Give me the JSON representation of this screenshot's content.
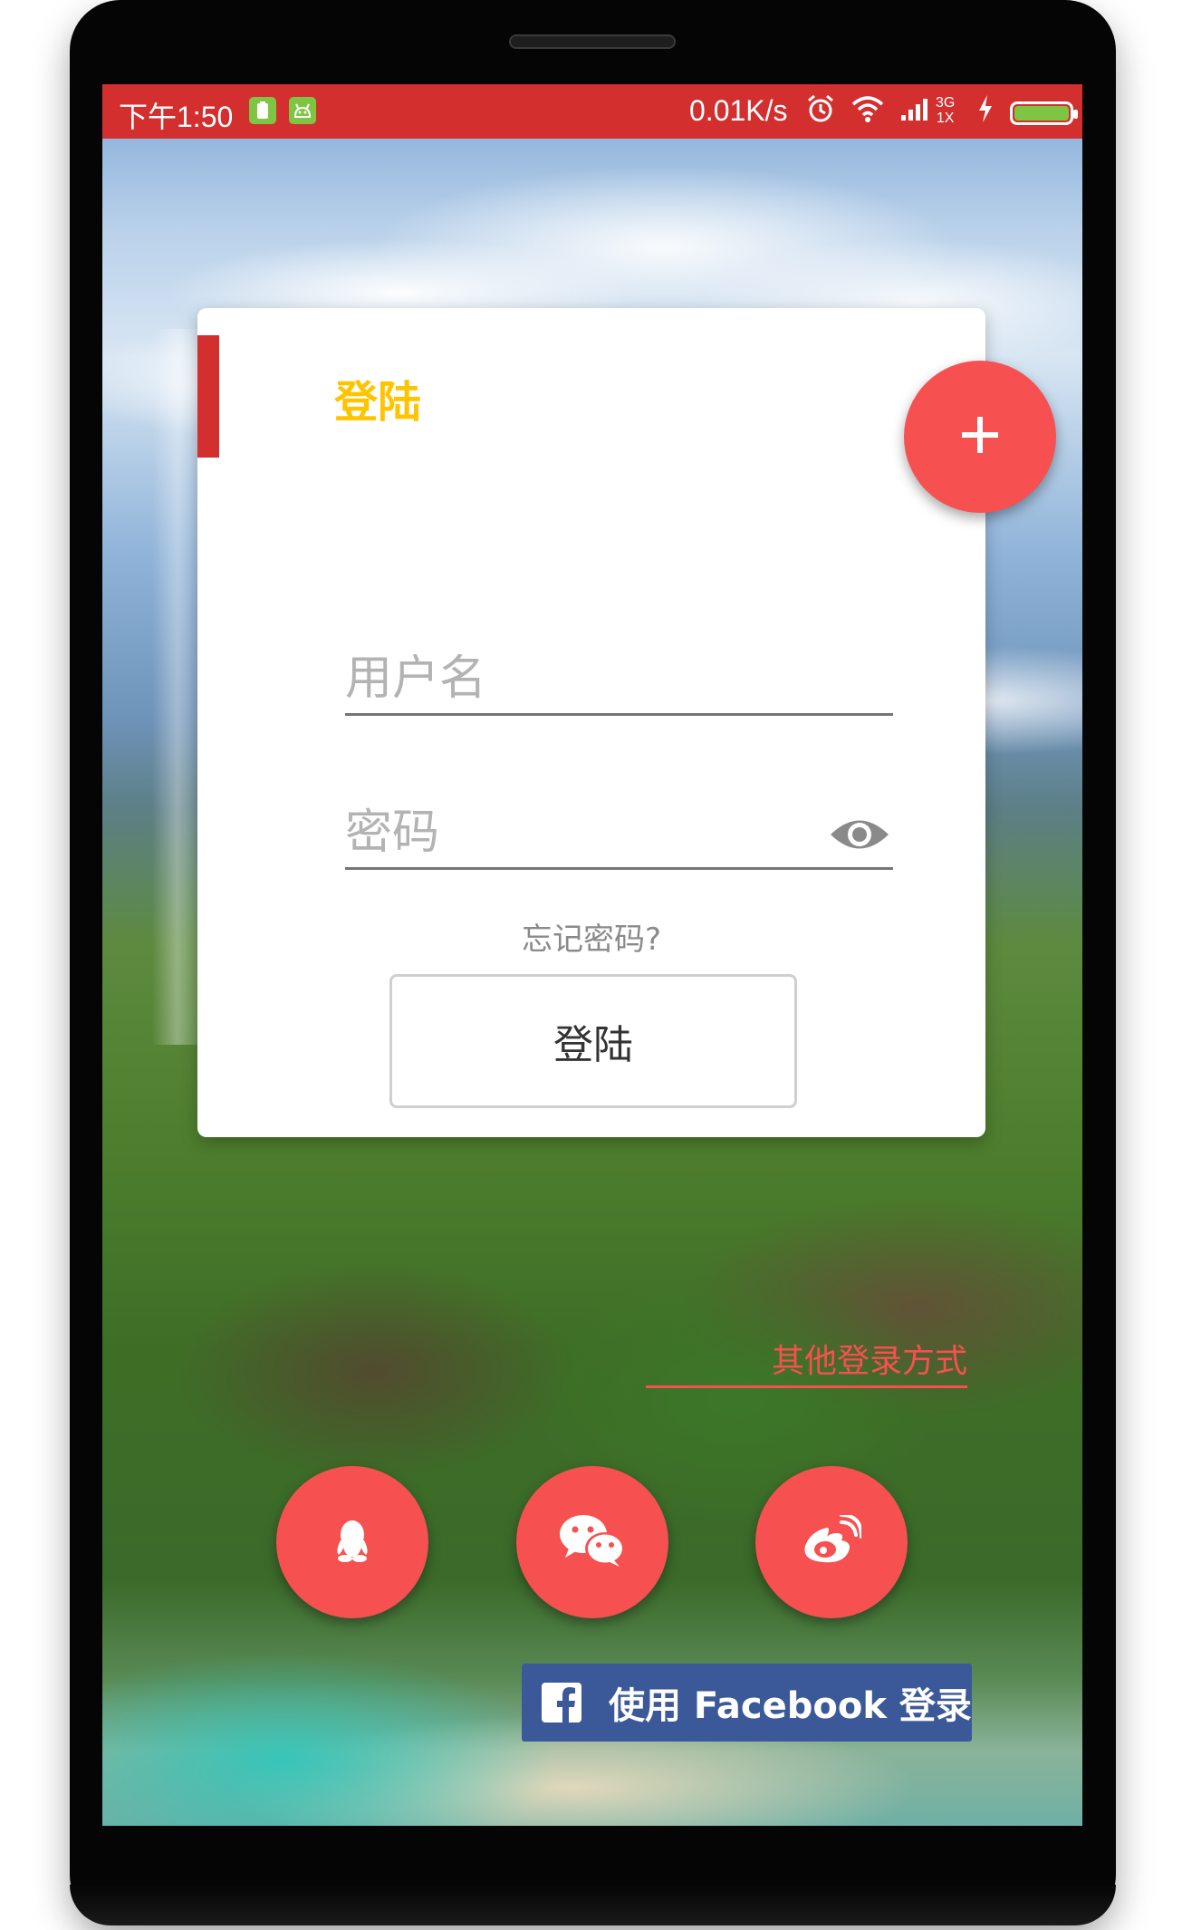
{
  "status_bar": {
    "time": "下午1:50",
    "net_speed": "0.01K/s",
    "signal_label_top": "3G",
    "signal_label_bottom": "1X"
  },
  "login_card": {
    "title": "登陆",
    "username_placeholder": "用户名",
    "password_placeholder": "密码",
    "login_button_label": "登陆",
    "forgot_password_label": "忘记密码?"
  },
  "other_login": {
    "label": "其他登录方式",
    "facebook_label": "使用 Facebook 登录"
  },
  "colors": {
    "status_bar": "#d32f2f",
    "accent_red": "#f75050",
    "title_yellow": "#ffc400",
    "facebook_blue": "#3b5998"
  },
  "icons": {
    "fab": "plus-icon",
    "social": [
      "qq-icon",
      "wechat-icon",
      "weibo-icon"
    ],
    "facebook": "facebook-logo-icon",
    "password_toggle": "eye-icon"
  }
}
